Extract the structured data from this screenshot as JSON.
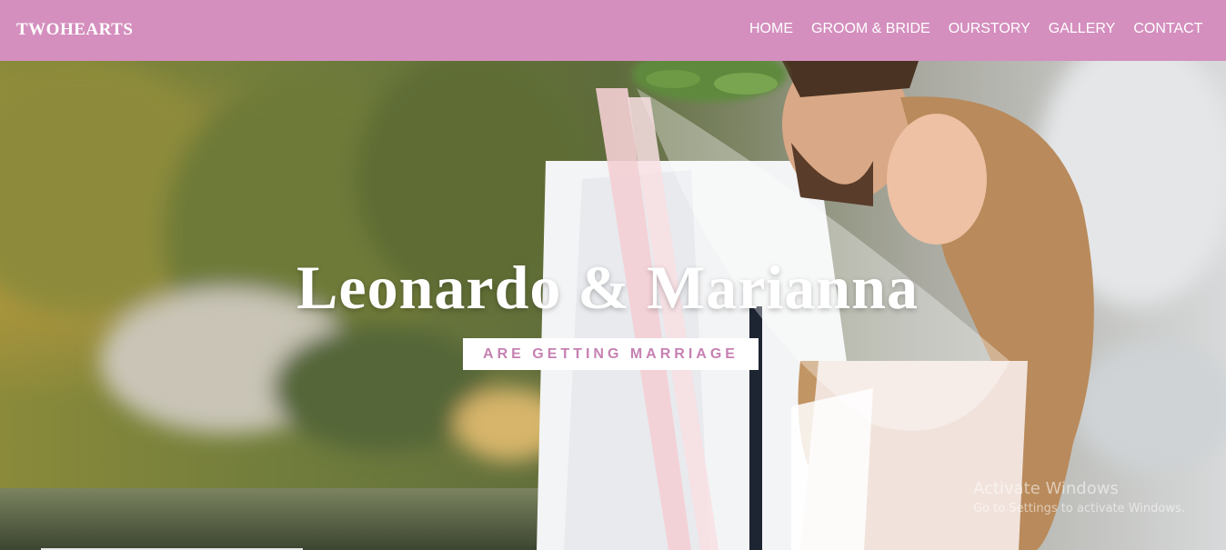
{
  "brand": "TWOHEARTS",
  "nav": [
    {
      "label": "HOME"
    },
    {
      "label": "GROOM & BRIDE"
    },
    {
      "label": "OURSTORY"
    },
    {
      "label": "GALLERY"
    },
    {
      "label": "CONTACT"
    }
  ],
  "hero": {
    "title": "Leonardo & Marianna",
    "subtitle": "ARE GETTING MARRIAGE"
  },
  "watermark": {
    "title": "Activate Windows",
    "subtitle": "Go to Settings to activate Windows."
  },
  "colors": {
    "navbar": "#d48fbe",
    "accent_text": "#c681b2"
  }
}
